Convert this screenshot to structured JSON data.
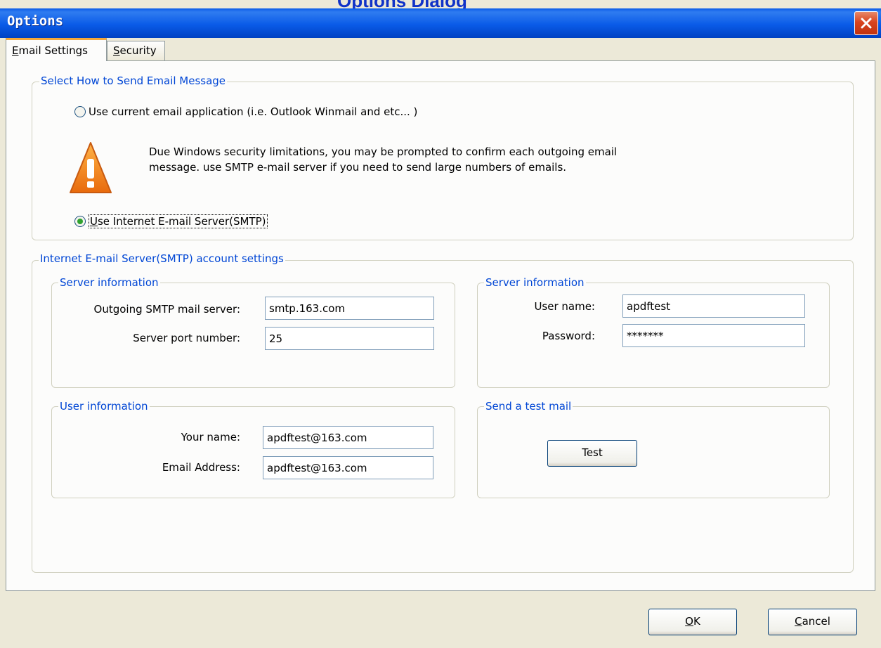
{
  "window": {
    "title": "Options",
    "bg_heading": "Options Dialog"
  },
  "tabs": [
    {
      "label": "Email Settings",
      "accel": "E",
      "rest": "mail Settings",
      "active": true
    },
    {
      "label": "Security",
      "accel": "S",
      "rest": "ecurity",
      "active": false
    }
  ],
  "send_method": {
    "legend": "Select How to Send Email Message",
    "option_current": "Use current email application (i.e. Outlook Winmail and etc... )",
    "warning_line1": "Due Windows security limitations,  you may be prompted to confirm each outgoing email",
    "warning_line2": "message. use SMTP e-mail server if you need to send large numbers of emails.",
    "option_smtp": "Use Internet E-mail Server(SMTP)",
    "option_smtp_accel": "U",
    "option_smtp_rest": "se Internet E-mail Server(SMTP)",
    "selected": "smtp"
  },
  "smtp": {
    "legend": "Internet E-mail Server(SMTP) account settings",
    "server_info": {
      "legend": "Server information",
      "outgoing_label": "Outgoing SMTP mail server:",
      "outgoing_value": "smtp.163.com",
      "port_label": "Server port number:",
      "port_value": "25"
    },
    "server_info_auth": {
      "legend": "Server information",
      "username_label": "User name:",
      "username_value": "apdftest",
      "password_label": "Password:",
      "password_value": "*******"
    },
    "user_info": {
      "legend": "User information",
      "name_label": "Your name:",
      "name_value": "apdftest@163.com",
      "email_label": "Email Address:",
      "email_value": "apdftest@163.com"
    },
    "test_mail": {
      "legend": "Send a test mail",
      "button": "Test"
    }
  },
  "footer": {
    "ok": "OK",
    "ok_accel": "O",
    "ok_rest": "K",
    "cancel": "Cancel",
    "cancel_accel": "C",
    "cancel_rest": "ancel"
  },
  "colors": {
    "titlebar": "#0a5be8",
    "legend_text": "#0046d5",
    "tab_highlight": "#f5a73a"
  }
}
